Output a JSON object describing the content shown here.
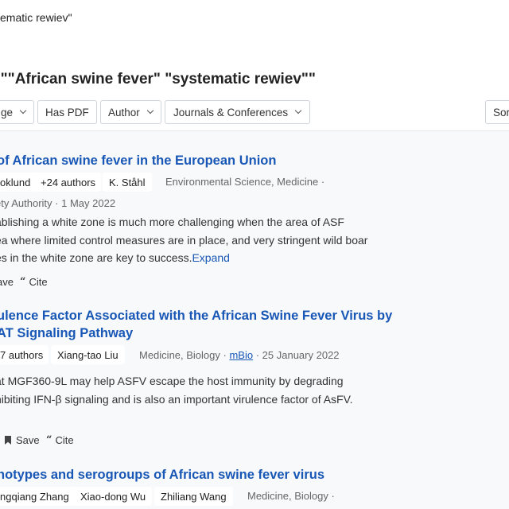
{
  "search": {
    "query": "\"African swine fever\" \"systematic rewiev\"",
    "visible_value": "ematic rewiev\""
  },
  "results": {
    "title": "r \"\"African swine fever\" \"systematic rewiev\"\""
  },
  "filters": {
    "date_label": "ge",
    "has_pdf": "Has PDF",
    "author": "Author",
    "journals": "Journals & Conferences",
    "sort": "Sor"
  },
  "papers": [
    {
      "title_lines": [
        "of African swine fever in the European Union"
      ],
      "authors": [
        "oklund",
        "+24 authors",
        "K. Ståhl"
      ],
      "fields": "Environmental Science, Medicine",
      "meta_line2": "ety Authority",
      "date": "1 May 2022",
      "abstract_lines": [
        "ablishing a white zone is much more challenging when the area of ASF",
        "ea where limited control measures are in place, and very stringent wild boar",
        "es in the white zone are key to success."
      ],
      "expand": "Expand",
      "save": "ave",
      "cite": "Cite"
    },
    {
      "title_lines": [
        "ulence Factor Associated with the African Swine Fever Virus by",
        "AT Signaling Pathway"
      ],
      "authors": [
        "7 authors",
        "Xiang-tao Liu"
      ],
      "fields": "Medicine, Biology",
      "venue": "mBio",
      "date": "25 January 2022",
      "abstract_lines": [
        "at MGF360-9L may help ASFV escape the host immunity by degrading",
        "hibiting IFN-β signaling and is also an important virulence factor of AsFV."
      ],
      "save": "Save",
      "cite": "Cite"
    },
    {
      "title_lines": [
        "notypes and serogroups of African swine fever virus"
      ],
      "authors": [
        "ngqiang Zhang",
        "Xiao-dong Wu",
        "Zhiliang Wang"
      ],
      "fields": "Medicine, Biology"
    }
  ],
  "colors": {
    "link": "#1857b6",
    "background": "#f8f9fa"
  }
}
